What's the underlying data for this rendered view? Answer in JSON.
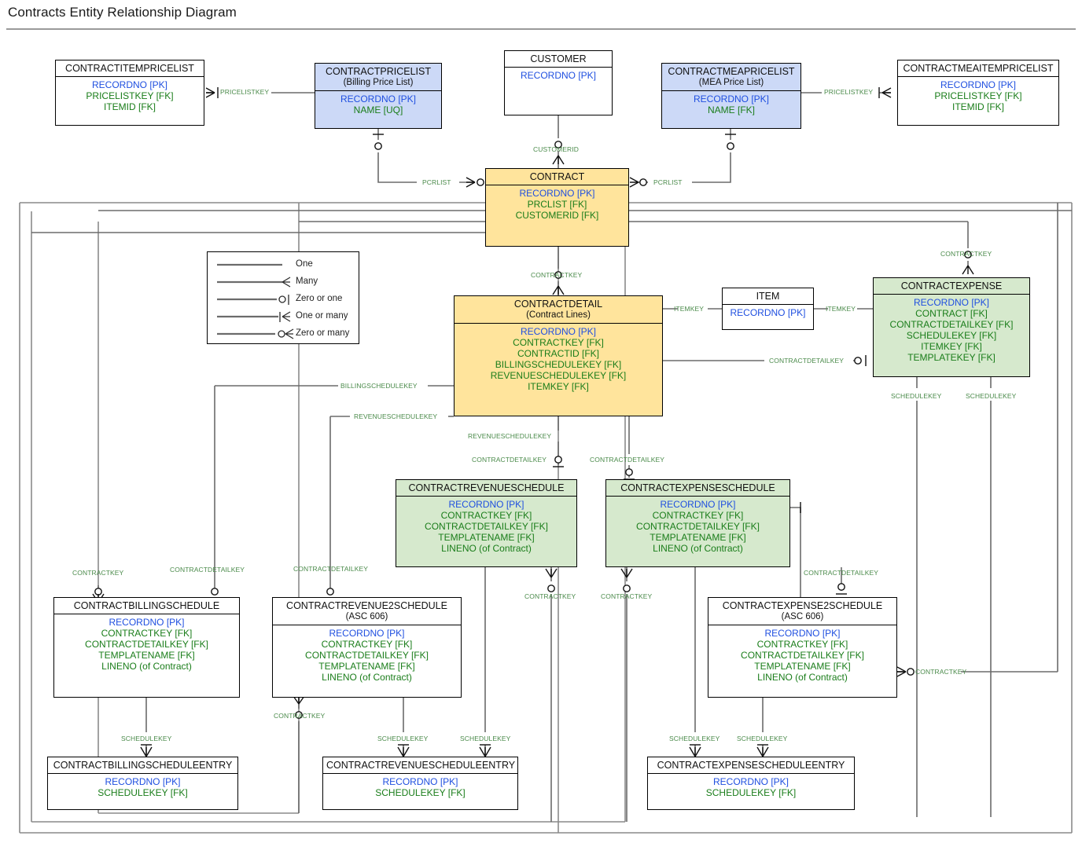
{
  "page": {
    "title": "Contracts Entity Relationship Diagram"
  },
  "legend": {
    "items": [
      {
        "label": "One",
        "symbol": "one"
      },
      {
        "label": "Many",
        "symbol": "many"
      },
      {
        "label": "Zero or one",
        "symbol": "zero-or-one"
      },
      {
        "label": "One or many",
        "symbol": "one-or-many"
      },
      {
        "label": "Zero or many",
        "symbol": "zero-or-many"
      }
    ]
  },
  "colors": {
    "blue_fill": "#ccd9f7",
    "orange_fill": "#ffe49c",
    "green_fill": "#d6e9cd",
    "white_fill": "#ffffff",
    "pk_text": "#1f4fe0",
    "fk_text": "#1a7d1a",
    "edge_label": "#4a8a4a",
    "line": "#6b6b6b"
  },
  "entities": [
    {
      "id": "contractitempricelist",
      "name": "CONTRACTITEMPRICELIST",
      "subtitle": "",
      "fill": "white",
      "attributes": [
        {
          "text": "RECORDNO [PK]",
          "key": "pk"
        },
        {
          "text": "PRICELISTKEY [FK]",
          "key": "fk"
        },
        {
          "text": "ITEMID [FK]",
          "key": "fk"
        }
      ]
    },
    {
      "id": "contractpricelist",
      "name": "CONTRACTPRICELIST",
      "subtitle": "(Billing Price List)",
      "fill": "blue",
      "attributes": [
        {
          "text": "RECORDNO [PK]",
          "key": "pk"
        },
        {
          "text": "NAME [UQ]",
          "key": "fk"
        }
      ]
    },
    {
      "id": "customer",
      "name": "CUSTOMER",
      "subtitle": "",
      "fill": "white",
      "attributes": [
        {
          "text": "RECORDNO [PK]",
          "key": "pk"
        }
      ]
    },
    {
      "id": "contractmeapricelist",
      "name": "CONTRACTMEAPRICELIST",
      "subtitle": "(MEA Price List)",
      "fill": "blue",
      "attributes": [
        {
          "text": "RECORDNO [PK]",
          "key": "pk"
        },
        {
          "text": "NAME [FK]",
          "key": "fk"
        }
      ]
    },
    {
      "id": "contractmeaitempricelist",
      "name": "CONTRACTMEAITEMPRICELIST",
      "subtitle": "",
      "fill": "white",
      "attributes": [
        {
          "text": "RECORDNO [PK]",
          "key": "pk"
        },
        {
          "text": "PRICELISTKEY [FK]",
          "key": "fk"
        },
        {
          "text": "ITEMID [FK]",
          "key": "fk"
        }
      ]
    },
    {
      "id": "contract",
      "name": "CONTRACT",
      "subtitle": "",
      "fill": "orange",
      "attributes": [
        {
          "text": "RECORDNO [PK]",
          "key": "pk"
        },
        {
          "text": "PRCLIST [FK]",
          "key": "fk"
        },
        {
          "text": "CUSTOMERID [FK]",
          "key": "fk"
        }
      ]
    },
    {
      "id": "contractdetail",
      "name": "CONTRACTDETAIL",
      "subtitle": "(Contract Lines)",
      "fill": "orange",
      "attributes": [
        {
          "text": "RECORDNO [PK]",
          "key": "pk"
        },
        {
          "text": "CONTRACTKEY [FK]",
          "key": "fk"
        },
        {
          "text": "CONTRACTID [FK]",
          "key": "fk"
        },
        {
          "text": "BILLINGSCHEDULEKEY [FK]",
          "key": "fk"
        },
        {
          "text": "REVENUESCHEDULEKEY [FK]",
          "key": "fk"
        },
        {
          "text": "ITEMKEY [FK]",
          "key": "fk"
        }
      ]
    },
    {
      "id": "item",
      "name": "ITEM",
      "subtitle": "",
      "fill": "white",
      "attributes": [
        {
          "text": "RECORDNO [PK]",
          "key": "pk"
        }
      ]
    },
    {
      "id": "contractexpense",
      "name": "CONTRACTEXPENSE",
      "subtitle": "",
      "fill": "green",
      "attributes": [
        {
          "text": "RECORDNO [PK]",
          "key": "pk"
        },
        {
          "text": "CONTRACT [FK]",
          "key": "fk"
        },
        {
          "text": "CONTRACTDETAILKEY [FK]",
          "key": "fk"
        },
        {
          "text": "SCHEDULEKEY [FK]",
          "key": "fk"
        },
        {
          "text": "ITEMKEY [FK]",
          "key": "fk"
        },
        {
          "text": "TEMPLATEKEY [FK]",
          "key": "fk"
        }
      ]
    },
    {
      "id": "contractrevenueschedule",
      "name": "CONTRACTREVENUESCHEDULE",
      "subtitle": "",
      "fill": "green",
      "attributes": [
        {
          "text": "RECORDNO [PK]",
          "key": "pk"
        },
        {
          "text": "CONTRACTKEY [FK]",
          "key": "fk"
        },
        {
          "text": "CONTRACTDETAILKEY [FK]",
          "key": "fk"
        },
        {
          "text": "TEMPLATENAME [FK]",
          "key": "fk"
        },
        {
          "text": "LINENO (of Contract)",
          "key": "fk"
        }
      ]
    },
    {
      "id": "contractexpenseschedule",
      "name": "CONTRACTEXPENSESCHEDULE",
      "subtitle": "",
      "fill": "green",
      "attributes": [
        {
          "text": "RECORDNO [PK]",
          "key": "pk"
        },
        {
          "text": "CONTRACTKEY [FK]",
          "key": "fk"
        },
        {
          "text": "CONTRACTDETAILKEY [FK]",
          "key": "fk"
        },
        {
          "text": "TEMPLATENAME [FK]",
          "key": "fk"
        },
        {
          "text": "LINENO (of Contract)",
          "key": "fk"
        }
      ]
    },
    {
      "id": "contractbillingschedule",
      "name": "CONTRACTBILLINGSCHEDULE",
      "subtitle": "",
      "fill": "white",
      "attributes": [
        {
          "text": "RECORDNO [PK]",
          "key": "pk"
        },
        {
          "text": "CONTRACTKEY [FK]",
          "key": "fk"
        },
        {
          "text": "CONTRACTDETAILKEY  [FK]",
          "key": "fk"
        },
        {
          "text": "TEMPLATENAME [FK]",
          "key": "fk"
        },
        {
          "text": "LINENO (of Contract)",
          "key": "fk"
        }
      ]
    },
    {
      "id": "contractrevenue2schedule",
      "name": "CONTRACTREVENUE2SCHEDULE",
      "subtitle": "(ASC 606)",
      "fill": "white",
      "attributes": [
        {
          "text": "RECORDNO [PK]",
          "key": "pk"
        },
        {
          "text": "CONTRACTKEY [FK]",
          "key": "fk"
        },
        {
          "text": "CONTRACTDETAILKEY [FK]",
          "key": "fk"
        },
        {
          "text": "TEMPLATENAME [FK]",
          "key": "fk"
        },
        {
          "text": "LINENO (of Contract)",
          "key": "fk"
        }
      ]
    },
    {
      "id": "contractexpense2schedule",
      "name": "CONTRACTEXPENSE2SCHEDULE",
      "subtitle": "(ASC 606)",
      "fill": "white",
      "attributes": [
        {
          "text": "RECORDNO [PK]",
          "key": "pk"
        },
        {
          "text": "CONTRACTKEY [FK]",
          "key": "fk"
        },
        {
          "text": "CONTRACTDETAILKEY [FK]",
          "key": "fk"
        },
        {
          "text": "TEMPLATENAME [FK]",
          "key": "fk"
        },
        {
          "text": "LINENO (of Contract)",
          "key": "fk"
        }
      ]
    },
    {
      "id": "contractbillingscheduleentry",
      "name": "CONTRACTBILLINGSCHEDULEENTRY",
      "subtitle": "",
      "fill": "white",
      "attributes": [
        {
          "text": "RECORDNO [PK]",
          "key": "pk"
        },
        {
          "text": "SCHEDULEKEY [FK]",
          "key": "fk"
        }
      ]
    },
    {
      "id": "contractrevenuescheduleentry",
      "name": "CONTRACTREVENUESCHEDULEENTRY",
      "subtitle": "",
      "fill": "white",
      "attributes": [
        {
          "text": "RECORDNO [PK]",
          "key": "pk"
        },
        {
          "text": "SCHEDULEKEY [FK]",
          "key": "fk"
        }
      ]
    },
    {
      "id": "contractexpensescheduleentry",
      "name": "CONTRACTEXPENSESCHEDULEENTRY",
      "subtitle": "",
      "fill": "white",
      "attributes": [
        {
          "text": "RECORDNO [PK]",
          "key": "pk"
        },
        {
          "text": "SCHEDULEKEY [FK]",
          "key": "fk"
        }
      ]
    }
  ],
  "edge_labels": [
    {
      "id": "l1",
      "text": "PRICELISTKEY"
    },
    {
      "id": "l2",
      "text": "PRICELISTKEY"
    },
    {
      "id": "l3",
      "text": "CUSTOMERID"
    },
    {
      "id": "l4",
      "text": "PCRLIST"
    },
    {
      "id": "l5",
      "text": "PCRLIST"
    },
    {
      "id": "l6",
      "text": "CONTRACTKEY"
    },
    {
      "id": "l7",
      "text": "CONTRACTKEY"
    },
    {
      "id": "l8",
      "text": "ITEMKEY"
    },
    {
      "id": "l9",
      "text": "ITEMKEY"
    },
    {
      "id": "l10",
      "text": "CONTRACTDETAILKEY"
    },
    {
      "id": "l11",
      "text": "BILLINGSCHEDULEKEY"
    },
    {
      "id": "l12",
      "text": "REVENUESCHEDULEKEY"
    },
    {
      "id": "l13",
      "text": "REVENUESCHEDULEKEY"
    },
    {
      "id": "l14",
      "text": "CONTRACTDETAILKEY"
    },
    {
      "id": "l15",
      "text": "CONTRACTDETAILKEY"
    },
    {
      "id": "l16",
      "text": "SCHEDULEKEY"
    },
    {
      "id": "l17",
      "text": "SCHEDULEKEY"
    },
    {
      "id": "l18",
      "text": "CONTRACTKEY"
    },
    {
      "id": "l19",
      "text": "CONTRACTDETAILKEY"
    },
    {
      "id": "l20",
      "text": "CONTRACTDETAILKEY"
    },
    {
      "id": "l21",
      "text": "CONTRACTDETAILKEY"
    },
    {
      "id": "l22",
      "text": "CONTRACTKEY"
    },
    {
      "id": "l23",
      "text": "CONTRACTKEY"
    },
    {
      "id": "l24",
      "text": "CONTRACTKEY"
    },
    {
      "id": "l25",
      "text": "CONTRACTKEY"
    },
    {
      "id": "l26",
      "text": "SCHEDULEKEY"
    },
    {
      "id": "l27",
      "text": "SCHEDULEKEY"
    },
    {
      "id": "l28",
      "text": "SCHEDULEKEY"
    },
    {
      "id": "l29",
      "text": "SCHEDULEKEY"
    },
    {
      "id": "l30",
      "text": "SCHEDULEKEY"
    },
    {
      "id": "l31",
      "text": "CONTRACTKEY"
    }
  ]
}
